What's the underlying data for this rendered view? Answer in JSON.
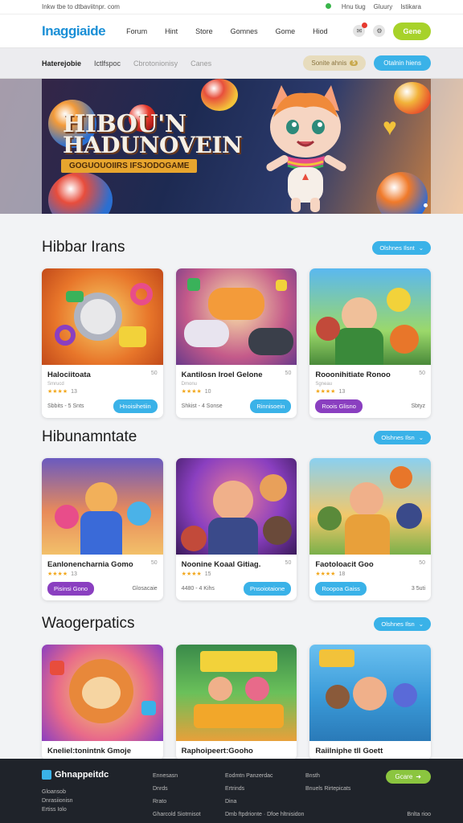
{
  "topbar": {
    "left": "Inkw tbe to dtbaviitnpr. com",
    "right": [
      "Hnu tiug",
      "Gluury",
      "Istikara"
    ]
  },
  "header": {
    "logo": "Inaggiaide",
    "nav": [
      "Forum",
      "Hint",
      "Store",
      "Gomnes",
      "Gome",
      "Hiod"
    ],
    "cta": "Gene"
  },
  "subbar": {
    "tabs": [
      "Haterejobie",
      "Ictlfspoc",
      "Cbrotonionisy",
      "Canes"
    ],
    "tan_button": "Sonite ahnis",
    "tan_count": "5",
    "blue_button": "Otalnin hiens"
  },
  "hero": {
    "title_line1": "HIBOU'N",
    "title_line2": "HADUNOVEIN",
    "banner": "GOGUOUOIIRS IFSJODOGAME"
  },
  "sections": [
    {
      "title": "Hibbar  Irans",
      "more": "Olshnes  Ilsnt",
      "cards": [
        {
          "title": "Halociitoata",
          "count": "50",
          "sub": "Smrucd",
          "reviews": "13",
          "meta": "Sbbits - 5 Snts",
          "button": "Hnoisihetiin",
          "purple": false
        },
        {
          "title": "Kantilosn Iroel Gelone",
          "count": "50",
          "sub": "Dmonu",
          "reviews": "10",
          "meta": "Shkist - 4 Sonse",
          "button": "Rinnisoein",
          "purple": false
        },
        {
          "title": "Rooonihitiate Ronoo",
          "count": "50",
          "sub": "Sgneau",
          "reviews": "13",
          "meta": "Sbtyz",
          "button": "Roois  Glisno",
          "purple": true
        }
      ]
    },
    {
      "title": "Hibunamntate",
      "more": "Olshnes  Ilsn",
      "cards": [
        {
          "title": "Eanlonencharnia Gomo",
          "count": "50",
          "sub": "",
          "reviews": "13",
          "meta": "Glosacaie",
          "button": "Pisinsi  Gono",
          "purple": true
        },
        {
          "title": "Noonine Koaal Gitiag.",
          "count": "50",
          "sub": "",
          "reviews": "15",
          "meta": "4480 - 4 Kihs",
          "button": "Pnsoiotaione",
          "purple": false
        },
        {
          "title": "Faotoloacit Goo",
          "count": "50",
          "sub": "",
          "reviews": "18",
          "meta": "3 5uti",
          "button": "Roopoa  Gaiss",
          "purple": false
        }
      ]
    },
    {
      "title": "Waogerpatics",
      "more": "Olshnes  Ilsn",
      "cards": [
        {
          "title": "Kneliel:tonintnk Gmoje",
          "count": "",
          "sub": "",
          "reviews": "",
          "meta": "",
          "button": "",
          "purple": false
        },
        {
          "title": "Raphoipeert:Gooho",
          "count": "",
          "sub": "",
          "reviews": "",
          "meta": "",
          "button": "",
          "purple": false
        },
        {
          "title": "Raiilniphe tll Goett",
          "count": "",
          "sub": "",
          "reviews": "",
          "meta": "",
          "button": "",
          "purple": false
        }
      ]
    }
  ],
  "footer": {
    "logo": "Ghnappeitdc",
    "left_lines": [
      "Gloansob",
      "Dnrasiionisn",
      "Ertiss Iolo"
    ],
    "col1": [
      "Ennesasn",
      "Dnrds",
      "Rrato",
      "Gharcold Siotrnisot"
    ],
    "col2": [
      "Eodmtn Panzerdac",
      "Ertrinds",
      "Dina",
      "Dmb ftpdrionte · Dfoe hltnisidon"
    ],
    "col3": [
      "Bnsth",
      "Bnuels Rirtepicats"
    ],
    "col4_bottom": "Bnlta rioo",
    "button": "Gcare"
  }
}
